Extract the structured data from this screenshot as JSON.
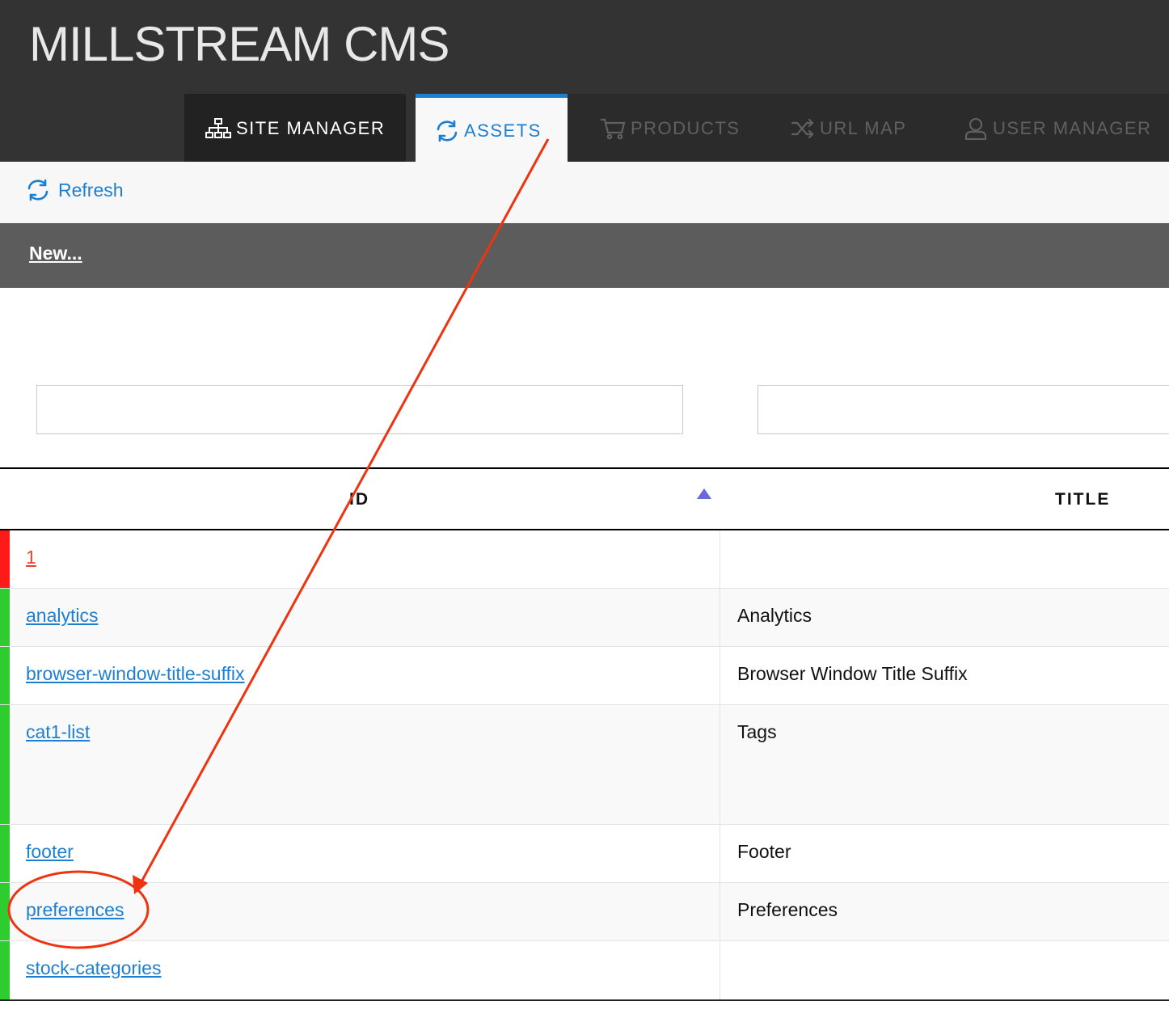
{
  "app": {
    "title": "MILLSTREAM CMS"
  },
  "tabs": [
    {
      "label": "SITE MANAGER",
      "icon": "sitemap-icon",
      "state": "normal"
    },
    {
      "label": "ASSETS",
      "icon": "sync-icon",
      "state": "active"
    },
    {
      "label": "PRODUCTS",
      "icon": "cart-icon",
      "state": "disabled"
    },
    {
      "label": "URL MAP",
      "icon": "shuffle-icon",
      "state": "disabled"
    },
    {
      "label": "USER MANAGER",
      "icon": "user-icon",
      "state": "disabled"
    }
  ],
  "toolbar": {
    "refresh_label": "Refresh",
    "new_label": "New..."
  },
  "filters": {
    "id_value": "",
    "title_value": ""
  },
  "table": {
    "columns": {
      "id": "ID",
      "title": "TITLE"
    },
    "sort": {
      "column": "ID",
      "direction": "ascending"
    },
    "rows": [
      {
        "id": "1",
        "title": "",
        "status": "error"
      },
      {
        "id": "analytics",
        "title": "Analytics",
        "status": "ok"
      },
      {
        "id": "browser-window-title-suffix",
        "title": "Browser Window Title Suffix",
        "status": "ok"
      },
      {
        "id": "cat1-list",
        "title": "Tags",
        "status": "ok"
      },
      {
        "id": "footer",
        "title": "Footer",
        "status": "ok"
      },
      {
        "id": "preferences",
        "title": "Preferences",
        "status": "ok"
      },
      {
        "id": "stock-categories",
        "title": "",
        "status": "ok"
      }
    ]
  },
  "colors": {
    "accent": "#1e7fd0",
    "status_ok": "#2ecc2e",
    "status_error": "#ff1a1a",
    "annotation": "#ee3311"
  }
}
